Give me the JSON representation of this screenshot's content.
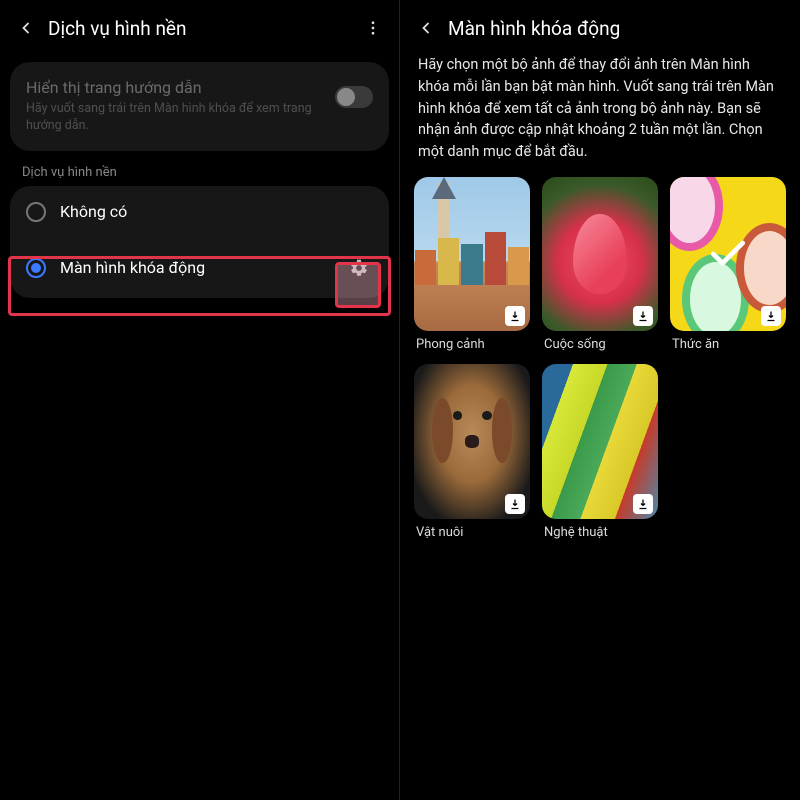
{
  "left": {
    "title": "Dịch vụ hình nền",
    "guide_title": "Hiển thị trang hướng dẫn",
    "guide_sub": "Hãy vuốt sang trái trên Màn hình khóa để xem trang hướng dẫn.",
    "guide_toggle": false,
    "section_label": "Dịch vụ hình nền",
    "options": [
      {
        "label": "Không có",
        "selected": false
      },
      {
        "label": "Màn hình khóa động",
        "selected": true,
        "has_gear": true
      }
    ]
  },
  "right": {
    "title": "Màn hình khóa động",
    "description": "Hãy chọn một bộ ảnh để thay đổi ảnh trên Màn hình khóa mỗi lần bạn bật màn hình. Vuốt sang trái trên Màn hình khóa để xem tất cả ảnh trong bộ ảnh này. Bạn sẽ nhận ảnh được cập nhật khoảng 2 tuần một lần. Chọn một danh mục để bắt đầu.",
    "categories": [
      {
        "label": "Phong cảnh",
        "thumb": "landscape",
        "downloadable": true,
        "checked": false
      },
      {
        "label": "Cuộc sống",
        "thumb": "life",
        "downloadable": true,
        "checked": false
      },
      {
        "label": "Thức ăn",
        "thumb": "food",
        "downloadable": true,
        "checked": true
      },
      {
        "label": "Vật nuôi",
        "thumb": "pet",
        "downloadable": true,
        "checked": false
      },
      {
        "label": "Nghệ thuật",
        "thumb": "art",
        "downloadable": true,
        "checked": false
      }
    ]
  },
  "colors": {
    "accent": "#3a7bff",
    "highlight": "#e3344a"
  }
}
